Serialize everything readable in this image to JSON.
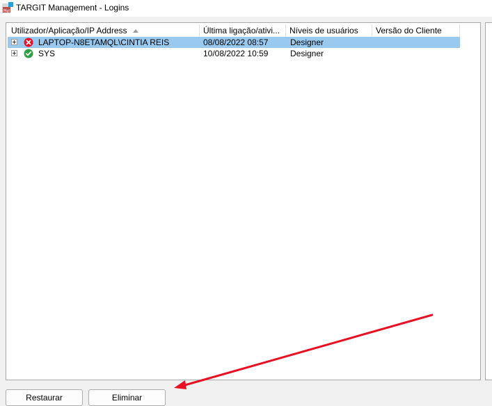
{
  "window": {
    "title": "TARGIT Management - Logins",
    "icon": "targit-app-icon"
  },
  "list": {
    "columns": [
      {
        "label": "Utilizador/Aplicação/IP Address",
        "sorted": "ascending"
      },
      {
        "label": "Última ligação/ativi..."
      },
      {
        "label": "Níveis de usuários"
      },
      {
        "label": "Versão do Cliente"
      }
    ],
    "rows": [
      {
        "name": "LAPTOP-N8ETAMQL\\CINTIA REIS",
        "last_login": "08/08/2022 08:57",
        "level": "Designer",
        "version": "",
        "status_icon": "error-x-icon",
        "status_color": "#e81123",
        "selected": true
      },
      {
        "name": "SYS",
        "last_login": "10/08/2022 10:59",
        "level": "Designer",
        "version": "",
        "status_icon": "check-icon",
        "status_color": "#2ea043",
        "selected": false
      }
    ],
    "selection_color": "#99c9ef"
  },
  "buttons": {
    "restore": "Restaurar",
    "delete": "Eliminar"
  },
  "annotation": {
    "arrow_color": "#e81123",
    "points_to": "delete-button"
  }
}
